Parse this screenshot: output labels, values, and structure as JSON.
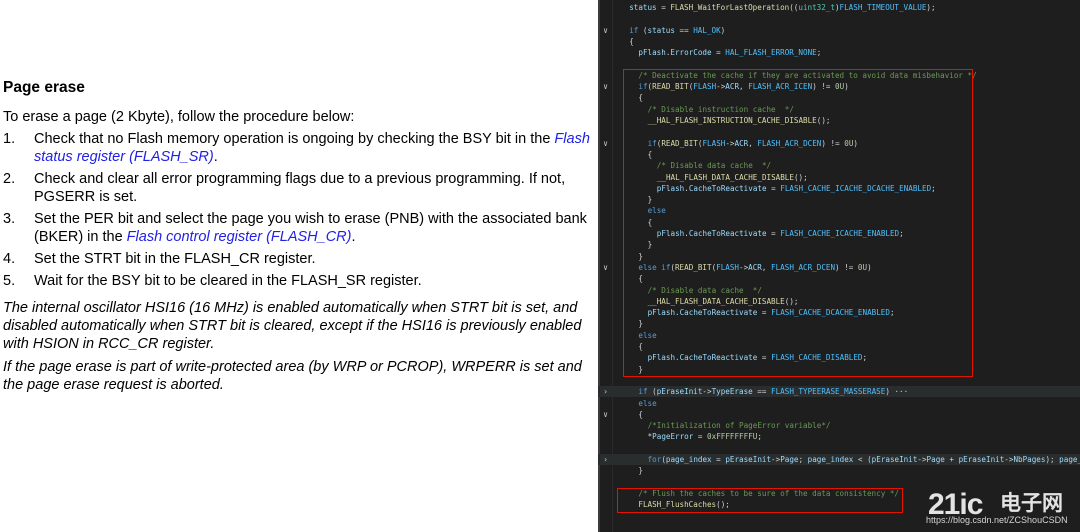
{
  "document": {
    "heading": "Page erase",
    "intro": "To erase a page (2 Kbyte), follow the procedure below:",
    "steps": [
      {
        "num": "1.",
        "text": "Check that no Flash memory operation is ongoing by checking the BSY bit in the ",
        "link": "Flash status register (FLASH_SR)",
        "after": "."
      },
      {
        "num": "2.",
        "text": "Check and clear all error programming flags due to a previous programming. If not, PGSERR is set.",
        "link": "",
        "after": ""
      },
      {
        "num": "3.",
        "text": "Set the PER bit and select the page you wish to erase (PNB) with the associated bank (BKER) in the ",
        "link": "Flash control register (FLASH_CR)",
        "after": "."
      },
      {
        "num": "4.",
        "text": "Set the STRT bit in the FLASH_CR register.",
        "link": "",
        "after": ""
      },
      {
        "num": "5.",
        "text": "Wait for the BSY bit to be cleared in the FLASH_SR register.",
        "link": "",
        "after": ""
      }
    ],
    "note1": "The internal oscillator HSI16 (16 MHz) is enabled automatically when STRT bit is set, and disabled automatically when STRT bit is cleared, except if the HSI16 is previously enabled with HSION in RCC_CR register.",
    "note2": "If the page erase is part of write-protected area (by WRP or PCROP), WRPERR is set and the page erase request is aborted."
  },
  "code": {
    "lines": [
      {
        "indent": 1,
        "fold": "",
        "tokens": [
          [
            "v",
            "status"
          ],
          [
            "p",
            " = "
          ],
          [
            "f",
            "FLASH_WaitForLastOperation"
          ],
          [
            "p",
            "(("
          ],
          [
            "t",
            "uint32_t"
          ],
          [
            "p",
            ")"
          ],
          [
            "m",
            "FLASH_TIMEOUT_VALUE"
          ],
          [
            "p",
            ");"
          ]
        ]
      },
      {
        "indent": 0,
        "fold": "",
        "tokens": []
      },
      {
        "indent": 1,
        "fold": "v",
        "tokens": [
          [
            "k",
            "if"
          ],
          [
            "p",
            " ("
          ],
          [
            "v",
            "status"
          ],
          [
            "p",
            " == "
          ],
          [
            "m",
            "HAL_OK"
          ],
          [
            "p",
            ")"
          ]
        ]
      },
      {
        "indent": 1,
        "fold": "",
        "tokens": [
          [
            "p",
            "{"
          ]
        ]
      },
      {
        "indent": 2,
        "fold": "",
        "tokens": [
          [
            "v",
            "pFlash"
          ],
          [
            "p",
            "."
          ],
          [
            "v",
            "ErrorCode"
          ],
          [
            "p",
            " = "
          ],
          [
            "m",
            "HAL_FLASH_ERROR_NONE"
          ],
          [
            "p",
            ";"
          ]
        ]
      },
      {
        "indent": 0,
        "fold": "",
        "tokens": []
      },
      {
        "indent": 2,
        "fold": "",
        "tokens": [
          [
            "c",
            "/* Deactivate the cache if they are activated to avoid data misbehavior */"
          ]
        ]
      },
      {
        "indent": 2,
        "fold": "v",
        "tokens": [
          [
            "k",
            "if"
          ],
          [
            "p",
            "("
          ],
          [
            "f",
            "READ_BIT"
          ],
          [
            "p",
            "("
          ],
          [
            "m",
            "FLASH"
          ],
          [
            "p",
            "->"
          ],
          [
            "v",
            "ACR"
          ],
          [
            "p",
            ", "
          ],
          [
            "m",
            "FLASH_ACR_ICEN"
          ],
          [
            "p",
            ") != "
          ],
          [
            "n",
            "0U"
          ],
          [
            "p",
            ")"
          ]
        ]
      },
      {
        "indent": 2,
        "fold": "",
        "tokens": [
          [
            "p",
            "{"
          ]
        ]
      },
      {
        "indent": 3,
        "fold": "",
        "tokens": [
          [
            "c",
            "/* Disable instruction cache  */"
          ]
        ]
      },
      {
        "indent": 3,
        "fold": "",
        "tokens": [
          [
            "f",
            "__HAL_FLASH_INSTRUCTION_CACHE_DISABLE"
          ],
          [
            "p",
            "();"
          ]
        ]
      },
      {
        "indent": 0,
        "fold": "",
        "tokens": []
      },
      {
        "indent": 3,
        "fold": "v",
        "tokens": [
          [
            "k",
            "if"
          ],
          [
            "p",
            "("
          ],
          [
            "f",
            "READ_BIT"
          ],
          [
            "p",
            "("
          ],
          [
            "m",
            "FLASH"
          ],
          [
            "p",
            "->"
          ],
          [
            "v",
            "ACR"
          ],
          [
            "p",
            ", "
          ],
          [
            "m",
            "FLASH_ACR_DCEN"
          ],
          [
            "p",
            ") != "
          ],
          [
            "n",
            "0U"
          ],
          [
            "p",
            ")"
          ]
        ]
      },
      {
        "indent": 3,
        "fold": "",
        "tokens": [
          [
            "p",
            "{"
          ]
        ]
      },
      {
        "indent": 4,
        "fold": "",
        "tokens": [
          [
            "c",
            "/* Disable data cache  */"
          ]
        ]
      },
      {
        "indent": 4,
        "fold": "",
        "tokens": [
          [
            "f",
            "__HAL_FLASH_DATA_CACHE_DISABLE"
          ],
          [
            "p",
            "();"
          ]
        ]
      },
      {
        "indent": 4,
        "fold": "",
        "tokens": [
          [
            "v",
            "pFlash"
          ],
          [
            "p",
            "."
          ],
          [
            "v",
            "CacheToReactivate"
          ],
          [
            "p",
            " = "
          ],
          [
            "m",
            "FLASH_CACHE_ICACHE_DCACHE_ENABLED"
          ],
          [
            "p",
            ";"
          ]
        ]
      },
      {
        "indent": 3,
        "fold": "",
        "tokens": [
          [
            "p",
            "}"
          ]
        ]
      },
      {
        "indent": 3,
        "fold": "",
        "tokens": [
          [
            "k",
            "else"
          ]
        ]
      },
      {
        "indent": 3,
        "fold": "",
        "tokens": [
          [
            "p",
            "{"
          ]
        ]
      },
      {
        "indent": 4,
        "fold": "",
        "tokens": [
          [
            "v",
            "pFlash"
          ],
          [
            "p",
            "."
          ],
          [
            "v",
            "CacheToReactivate"
          ],
          [
            "p",
            " = "
          ],
          [
            "m",
            "FLASH_CACHE_ICACHE_ENABLED"
          ],
          [
            "p",
            ";"
          ]
        ]
      },
      {
        "indent": 3,
        "fold": "",
        "tokens": [
          [
            "p",
            "}"
          ]
        ]
      },
      {
        "indent": 2,
        "fold": "",
        "tokens": [
          [
            "p",
            "}"
          ]
        ]
      },
      {
        "indent": 2,
        "fold": "v",
        "tokens": [
          [
            "k",
            "else if"
          ],
          [
            "p",
            "("
          ],
          [
            "f",
            "READ_BIT"
          ],
          [
            "p",
            "("
          ],
          [
            "m",
            "FLASH"
          ],
          [
            "p",
            "->"
          ],
          [
            "v",
            "ACR"
          ],
          [
            "p",
            ", "
          ],
          [
            "m",
            "FLASH_ACR_DCEN"
          ],
          [
            "p",
            ") != "
          ],
          [
            "n",
            "0U"
          ],
          [
            "p",
            ")"
          ]
        ]
      },
      {
        "indent": 2,
        "fold": "",
        "tokens": [
          [
            "p",
            "{"
          ]
        ]
      },
      {
        "indent": 3,
        "fold": "",
        "tokens": [
          [
            "c",
            "/* Disable data cache  */"
          ]
        ]
      },
      {
        "indent": 3,
        "fold": "",
        "tokens": [
          [
            "f",
            "__HAL_FLASH_DATA_CACHE_DISABLE"
          ],
          [
            "p",
            "();"
          ]
        ]
      },
      {
        "indent": 3,
        "fold": "",
        "tokens": [
          [
            "v",
            "pFlash"
          ],
          [
            "p",
            "."
          ],
          [
            "v",
            "CacheToReactivate"
          ],
          [
            "p",
            " = "
          ],
          [
            "m",
            "FLASH_CACHE_DCACHE_ENABLED"
          ],
          [
            "p",
            ";"
          ]
        ]
      },
      {
        "indent": 2,
        "fold": "",
        "tokens": [
          [
            "p",
            "}"
          ]
        ]
      },
      {
        "indent": 2,
        "fold": "",
        "tokens": [
          [
            "k",
            "else"
          ]
        ]
      },
      {
        "indent": 2,
        "fold": "",
        "tokens": [
          [
            "p",
            "{"
          ]
        ]
      },
      {
        "indent": 3,
        "fold": "",
        "tokens": [
          [
            "v",
            "pFlash"
          ],
          [
            "p",
            "."
          ],
          [
            "v",
            "CacheToReactivate"
          ],
          [
            "p",
            " = "
          ],
          [
            "m",
            "FLASH_CACHE_DISABLED"
          ],
          [
            "p",
            ";"
          ]
        ]
      },
      {
        "indent": 2,
        "fold": "",
        "tokens": [
          [
            "p",
            "}"
          ]
        ]
      },
      {
        "indent": 0,
        "fold": "",
        "tokens": []
      },
      {
        "indent": 2,
        "fold": ">",
        "hl": true,
        "tokens": [
          [
            "k",
            "if"
          ],
          [
            "p",
            " ("
          ],
          [
            "v",
            "pEraseInit"
          ],
          [
            "p",
            "->"
          ],
          [
            "v",
            "TypeErase"
          ],
          [
            "p",
            " == "
          ],
          [
            "m",
            "FLASH_TYPEERASE_MASSERASE"
          ],
          [
            "p",
            ") ···"
          ]
        ]
      },
      {
        "indent": 2,
        "fold": "",
        "tokens": [
          [
            "k",
            "else"
          ]
        ]
      },
      {
        "indent": 2,
        "fold": "v",
        "tokens": [
          [
            "p",
            "{"
          ]
        ]
      },
      {
        "indent": 3,
        "fold": "",
        "tokens": [
          [
            "c",
            "/*Initialization of PageError variable*/"
          ]
        ]
      },
      {
        "indent": 3,
        "fold": "",
        "tokens": [
          [
            "p",
            "*"
          ],
          [
            "v",
            "PageError"
          ],
          [
            "p",
            " = "
          ],
          [
            "n",
            "0xFFFFFFFFU"
          ],
          [
            "p",
            ";"
          ]
        ]
      },
      {
        "indent": 0,
        "fold": "",
        "tokens": []
      },
      {
        "indent": 3,
        "fold": ">",
        "hl": true,
        "tokens": [
          [
            "k",
            "for"
          ],
          [
            "p",
            "("
          ],
          [
            "v",
            "page_index"
          ],
          [
            "p",
            " = "
          ],
          [
            "v",
            "pEraseInit"
          ],
          [
            "p",
            "->"
          ],
          [
            "v",
            "Page"
          ],
          [
            "p",
            "; "
          ],
          [
            "v",
            "page_index"
          ],
          [
            "p",
            " < ("
          ],
          [
            "v",
            "pEraseInit"
          ],
          [
            "p",
            "->"
          ],
          [
            "v",
            "Page"
          ],
          [
            "p",
            " + "
          ],
          [
            "v",
            "pEraseInit"
          ],
          [
            "p",
            "->"
          ],
          [
            "v",
            "NbPages"
          ],
          [
            "p",
            "); "
          ],
          [
            "v",
            "page_i"
          ]
        ]
      },
      {
        "indent": 2,
        "fold": "",
        "tokens": [
          [
            "p",
            "}"
          ]
        ]
      },
      {
        "indent": 0,
        "fold": "",
        "tokens": []
      },
      {
        "indent": 2,
        "fold": "",
        "tokens": [
          [
            "c",
            "/* Flush the caches to be sure of the data consistency */"
          ]
        ]
      },
      {
        "indent": 2,
        "fold": "",
        "tokens": [
          [
            "f",
            "FLASH_FlushCaches"
          ],
          [
            "p",
            "();"
          ]
        ]
      }
    ]
  },
  "watermark": {
    "logo": "21ic",
    "cn": "电子网",
    "url": "https://blog.csdn.net/ZCShouCSDN"
  }
}
